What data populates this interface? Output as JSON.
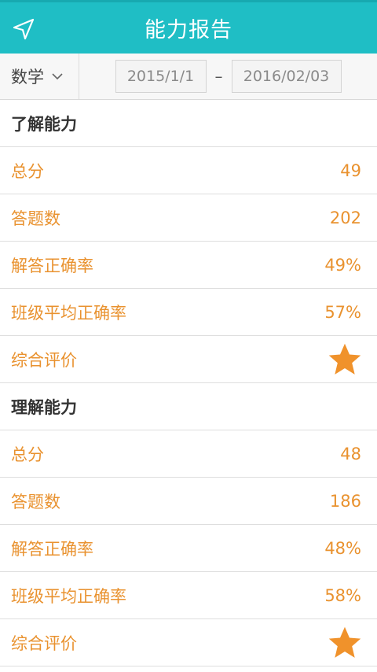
{
  "header": {
    "title": "能力报告",
    "back_icon": "navigation-arrow-icon"
  },
  "filter": {
    "subject": "数学",
    "date_start": "2015/1/1",
    "separator": "–",
    "date_end": "2016/02/03"
  },
  "colors": {
    "header_bg": "#1fbec5",
    "accent": "#e9922f"
  },
  "sections": [
    {
      "title": "了解能力",
      "rows": [
        {
          "label": "总分",
          "value": "49"
        },
        {
          "label": "答题数",
          "value": "202"
        },
        {
          "label": "解答正确率",
          "value": "49%"
        },
        {
          "label": "班级平均正确率",
          "value": "57%"
        },
        {
          "label": "综合评价",
          "stars": 1
        }
      ]
    },
    {
      "title": "理解能力",
      "rows": [
        {
          "label": "总分",
          "value": "48"
        },
        {
          "label": "答题数",
          "value": "186"
        },
        {
          "label": "解答正确率",
          "value": "48%"
        },
        {
          "label": "班级平均正确率",
          "value": "58%"
        },
        {
          "label": "综合评价",
          "stars": 1
        }
      ]
    }
  ]
}
